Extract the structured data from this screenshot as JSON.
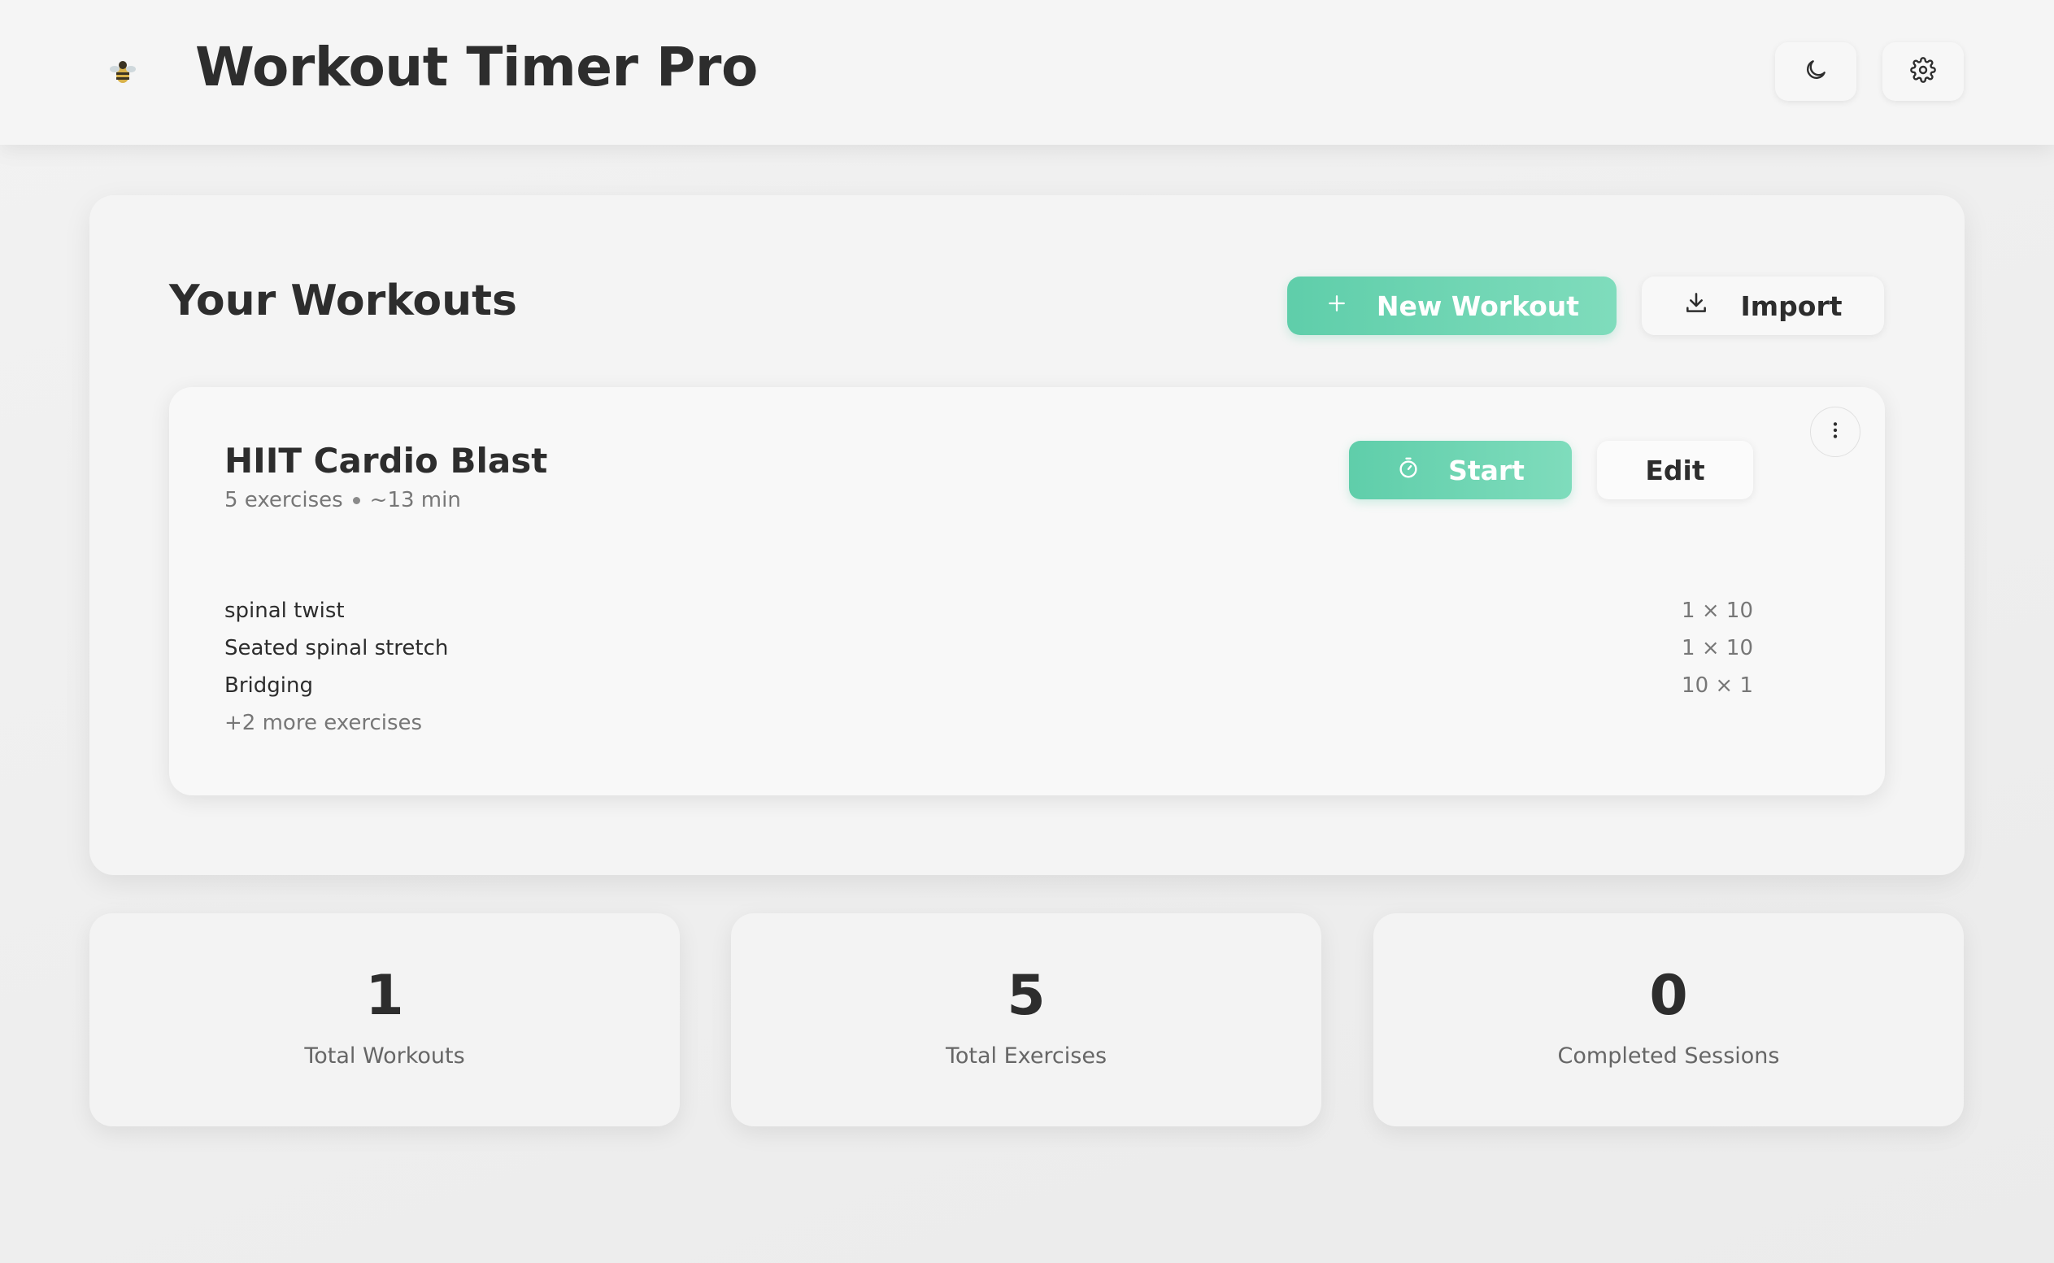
{
  "header": {
    "title": "Workout Timer Pro",
    "logo_icon": "bee-icon",
    "theme_toggle_icon": "moon-icon",
    "settings_icon": "gear-icon"
  },
  "workouts": {
    "title": "Your Workouts",
    "new_workout_label": "New Workout",
    "import_label": "Import",
    "cards": [
      {
        "name": "HIIT Cardio Blast",
        "exercise_count": "5 exercises",
        "duration": "~13 min",
        "start_label": "Start",
        "edit_label": "Edit",
        "exercises": [
          {
            "name": "spinal twist",
            "reps": "1 × 10"
          },
          {
            "name": "Seated spinal stretch",
            "reps": "1 × 10"
          },
          {
            "name": "Bridging",
            "reps": "10 × 1"
          }
        ],
        "more_label": "+2 more exercises"
      }
    ]
  },
  "stats": [
    {
      "value": "1",
      "label": "Total Workouts"
    },
    {
      "value": "5",
      "label": "Total Exercises"
    },
    {
      "value": "0",
      "label": "Completed Sessions"
    }
  ],
  "colors": {
    "accent": "#6fd6b4",
    "text": "#2d2d2d",
    "muted": "#777777",
    "background": "#eeeeee"
  }
}
